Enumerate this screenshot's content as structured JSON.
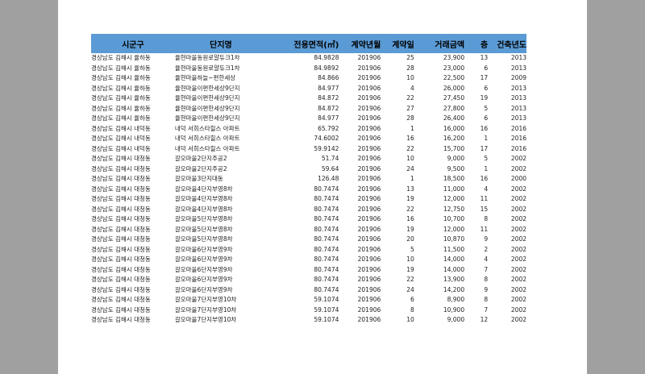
{
  "headers": [
    "시군구",
    "단지명",
    "전용면적(㎡)",
    "계약년월",
    "계약일",
    "거래금액",
    "층",
    "건축년도"
  ],
  "rows": [
    [
      "경상남도 김해시 율하동",
      "율현마을동원로얄듀크1차",
      "84.9828",
      "201906",
      "25",
      "23,900",
      "13",
      "2013"
    ],
    [
      "경상남도 김해시 율하동",
      "율현마을동원로얄듀크1차",
      "84.9892",
      "201906",
      "28",
      "23,000",
      "6",
      "2013"
    ],
    [
      "경상남도 김해시 율하동",
      "율현마을하늘~편한세상",
      "84.866",
      "201906",
      "10",
      "22,500",
      "17",
      "2009"
    ],
    [
      "경상남도 김해시 율하동",
      "율현마을이편한세상9단지",
      "84.977",
      "201906",
      "4",
      "26,000",
      "6",
      "2013"
    ],
    [
      "경상남도 김해시 율하동",
      "율현마을이편한세상9단지",
      "84.872",
      "201906",
      "22",
      "27,450",
      "19",
      "2013"
    ],
    [
      "경상남도 김해시 율하동",
      "율현마을이편한세상9단지",
      "84.872",
      "201906",
      "27",
      "27,800",
      "5",
      "2013"
    ],
    [
      "경상남도 김해시 율하동",
      "율현마을이편한세상9단지",
      "84.977",
      "201906",
      "28",
      "26,400",
      "6",
      "2013"
    ],
    [
      "경상남도 김해시 내덕동",
      "내덕 서희스타힐스 아파트",
      "65.792",
      "201906",
      "1",
      "16,000",
      "16",
      "2016"
    ],
    [
      "경상남도 김해시 내덕동",
      "내덕 서희스타힐스 아파트",
      "74.6002",
      "201906",
      "16",
      "16,200",
      "1",
      "2016"
    ],
    [
      "경상남도 김해시 내덕동",
      "내덕 서희스타힐스 아파트",
      "59.9142",
      "201906",
      "22",
      "15,700",
      "17",
      "2016"
    ],
    [
      "경상남도 김해시 대청동",
      "갈오마을2단지주공2",
      "51.74",
      "201906",
      "10",
      "9,000",
      "5",
      "2002"
    ],
    [
      "경상남도 김해시 대청동",
      "갈오마을2단지주공2",
      "59.64",
      "201906",
      "24",
      "9,500",
      "1",
      "2002"
    ],
    [
      "경상남도 김해시 대청동",
      "갈오마을3단지대동",
      "126.48",
      "201906",
      "1",
      "18,500",
      "16",
      "2000"
    ],
    [
      "경상남도 김해시 대청동",
      "갈오마을4단지부영8차",
      "80.7474",
      "201906",
      "13",
      "11,000",
      "4",
      "2002"
    ],
    [
      "경상남도 김해시 대청동",
      "갈오마을4단지부영8차",
      "80.7474",
      "201906",
      "19",
      "12,000",
      "11",
      "2002"
    ],
    [
      "경상남도 김해시 대청동",
      "갈오마을4단지부영8차",
      "80.7474",
      "201906",
      "22",
      "12,750",
      "15",
      "2002"
    ],
    [
      "경상남도 김해시 대청동",
      "갈오마을5단지부영8차",
      "80.7474",
      "201906",
      "16",
      "10,700",
      "8",
      "2002"
    ],
    [
      "경상남도 김해시 대청동",
      "갈오마을5단지부영8차",
      "80.7474",
      "201906",
      "19",
      "12,000",
      "11",
      "2002"
    ],
    [
      "경상남도 김해시 대청동",
      "갈오마을5단지부영8차",
      "80.7474",
      "201906",
      "20",
      "10,870",
      "9",
      "2002"
    ],
    [
      "경상남도 김해시 대청동",
      "갈오마을6단지부영9차",
      "80.7474",
      "201906",
      "5",
      "11,500",
      "2",
      "2002"
    ],
    [
      "경상남도 김해시 대청동",
      "갈오마을6단지부영9차",
      "80.7474",
      "201906",
      "10",
      "14,000",
      "4",
      "2002"
    ],
    [
      "경상남도 김해시 대청동",
      "갈오마을6단지부영9차",
      "80.7474",
      "201906",
      "19",
      "14,000",
      "7",
      "2002"
    ],
    [
      "경상남도 김해시 대청동",
      "갈오마을6단지부영9차",
      "80.7474",
      "201906",
      "22",
      "13,900",
      "8",
      "2002"
    ],
    [
      "경상남도 김해시 대청동",
      "갈오마을6단지부영9차",
      "80.7474",
      "201906",
      "24",
      "14,200",
      "9",
      "2002"
    ],
    [
      "경상남도 김해시 대청동",
      "갈오마을7단지부영10차",
      "59.1074",
      "201906",
      "6",
      "8,900",
      "8",
      "2002"
    ],
    [
      "경상남도 김해시 대청동",
      "갈오마을7단지부영10차",
      "59.1074",
      "201906",
      "8",
      "10,900",
      "7",
      "2002"
    ],
    [
      "경상남도 김해시 대청동",
      "갈오마을7단지부영10차",
      "59.1074",
      "201906",
      "10",
      "9,000",
      "12",
      "2002"
    ]
  ]
}
